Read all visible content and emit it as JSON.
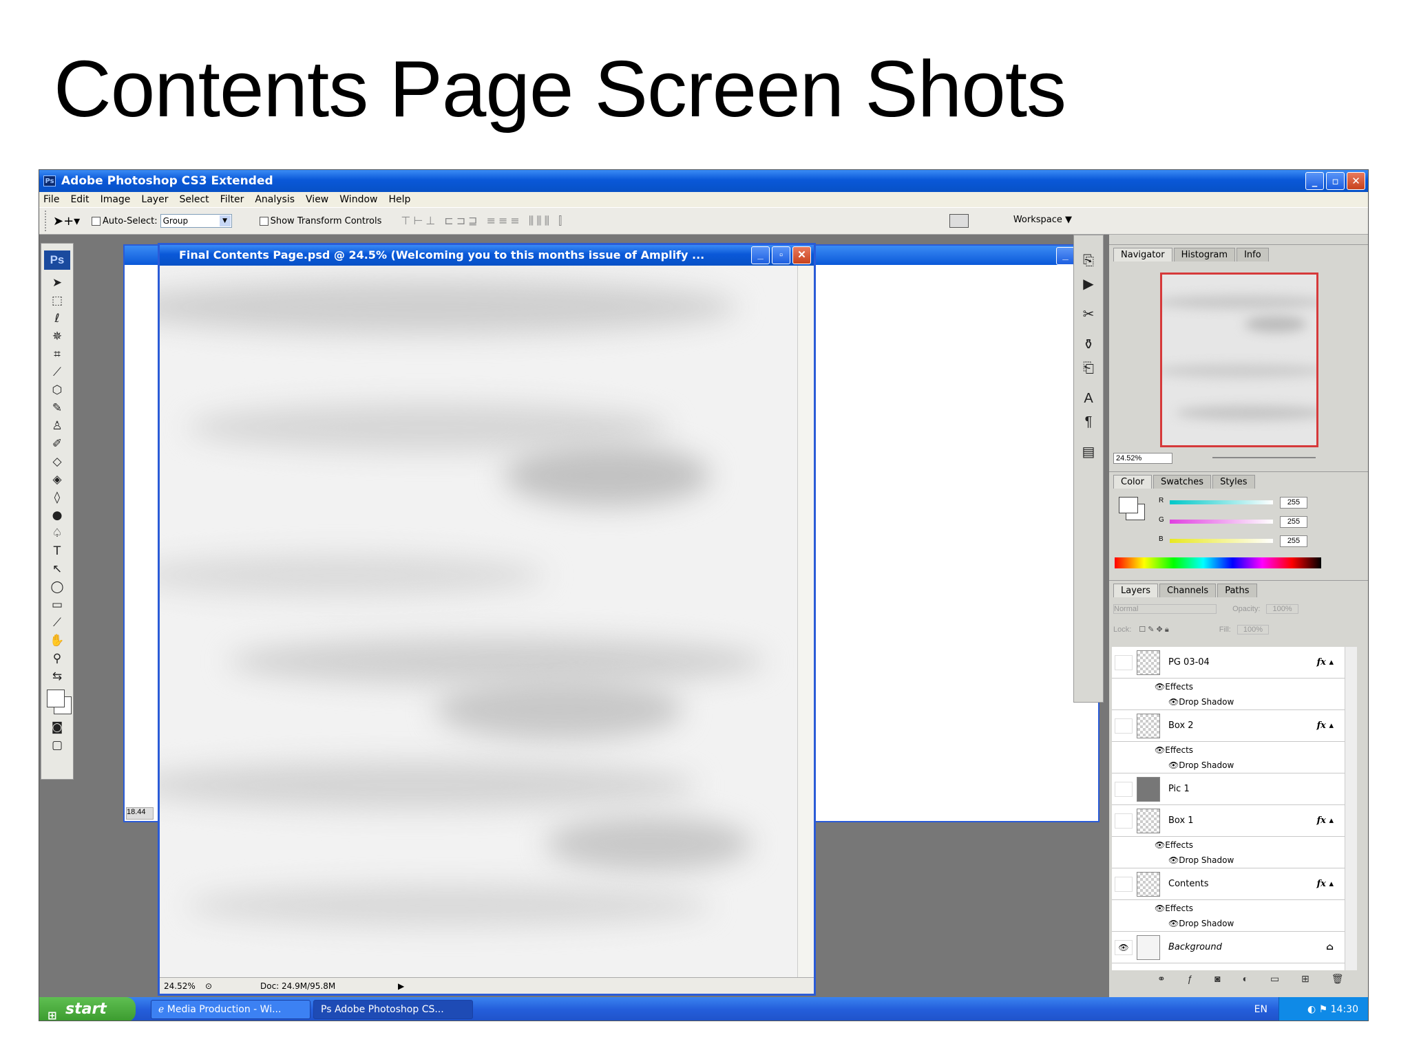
{
  "slide": {
    "title": "Contents Page Screen Shots"
  },
  "app": {
    "title": "Adobe Photoshop CS3 Extended",
    "menu": [
      "File",
      "Edit",
      "Image",
      "Layer",
      "Select",
      "Filter",
      "Analysis",
      "View",
      "Window",
      "Help"
    ],
    "options": {
      "auto_select_label": "Auto-Select:",
      "auto_select_value": "Group",
      "show_transform_label": "Show Transform Controls",
      "workspace_label": "Workspace ▼"
    }
  },
  "toolbox": {
    "logo": "Ps"
  },
  "document": {
    "title": "Final Contents Page.psd @ 24.5% (Welcoming you to this months issue of Amplify ...",
    "zoom": "24.52%",
    "doc_info": "Doc: 24.9M/95.8M",
    "back_zoom": "18.44"
  },
  "navigator": {
    "tabs": [
      "Navigator",
      "Histogram",
      "Info"
    ],
    "zoom": "24.52%"
  },
  "color_panel": {
    "tabs": [
      "Color",
      "Swatches",
      "Styles"
    ],
    "channels": [
      {
        "label": "R",
        "value": "255",
        "color": "#00c8c8"
      },
      {
        "label": "G",
        "value": "255",
        "color": "#e040e0"
      },
      {
        "label": "B",
        "value": "255",
        "color": "#e8e820"
      }
    ]
  },
  "layers_panel": {
    "tabs": [
      "Layers",
      "Channels",
      "Paths"
    ],
    "blend_mode": "Normal",
    "opacity_label": "Opacity:",
    "opacity_value": "100%",
    "lock_label": "Lock:",
    "fill_label": "Fill:",
    "fill_value": "100%",
    "effects_label": "Effects",
    "drop_shadow_label": "Drop Shadow",
    "layers": [
      {
        "name": "PG 03-04",
        "has_fx": true
      },
      {
        "name": "Box 2",
        "has_fx": true
      },
      {
        "name": "Pic 1",
        "has_fx": false
      },
      {
        "name": "Box 1",
        "has_fx": true
      },
      {
        "name": "Contents",
        "has_fx": true
      },
      {
        "name": "Background",
        "has_fx": false
      }
    ]
  },
  "taskbar": {
    "start": "start",
    "items": [
      "Media Production - Wi...",
      "Adobe Photoshop CS..."
    ],
    "language": "EN",
    "clock": "14:30"
  }
}
